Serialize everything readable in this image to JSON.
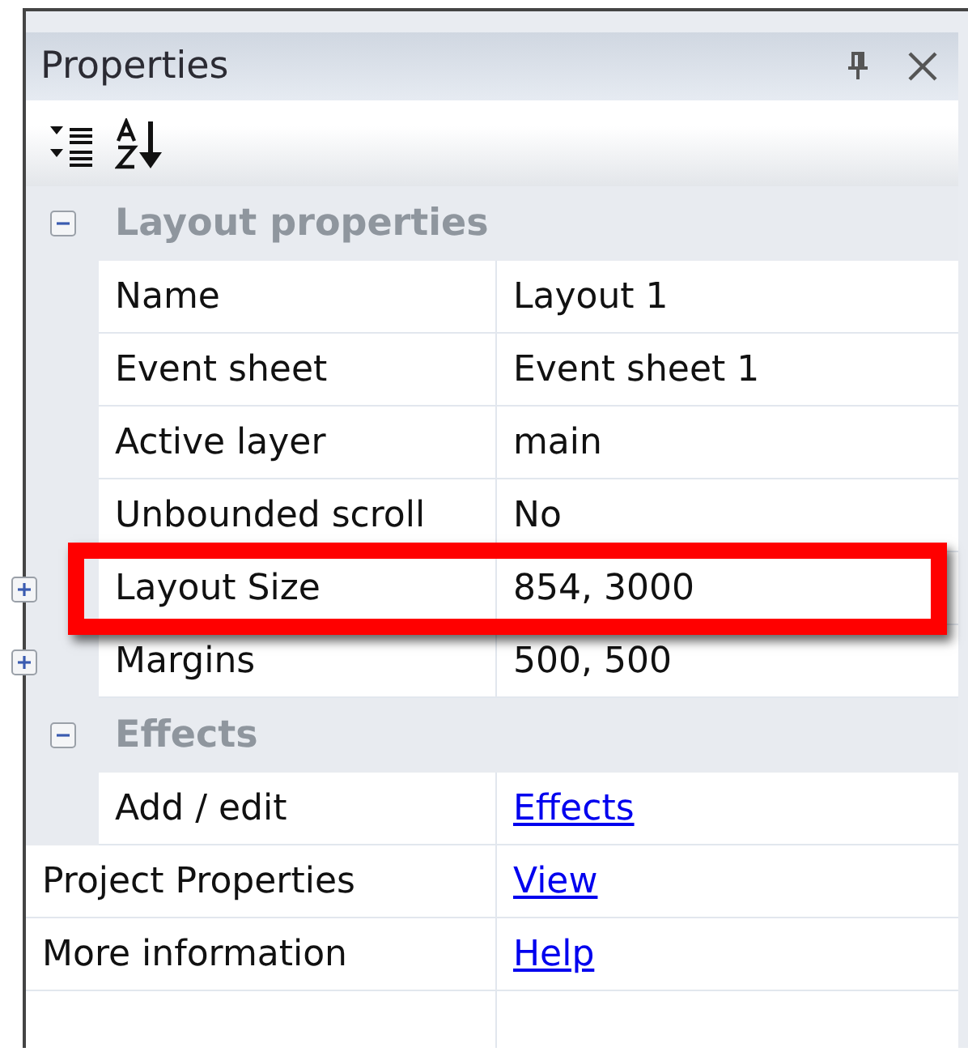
{
  "panel": {
    "title": "Properties"
  },
  "groups": [
    {
      "title": "Layout properties",
      "expanded": true,
      "properties": [
        {
          "name": "Name",
          "value": "Layout 1",
          "kind": "text",
          "highlighted": false
        },
        {
          "name": "Event sheet",
          "value": "Event sheet 1",
          "kind": "text",
          "highlighted": false
        },
        {
          "name": "Active layer",
          "value": "main",
          "kind": "text",
          "highlighted": false
        },
        {
          "name": "Unbounded scroll",
          "value": "No",
          "kind": "text",
          "highlighted": false
        },
        {
          "name": "Layout Size",
          "value": "854, 3000",
          "kind": "expandable",
          "expanded": false,
          "highlighted": true
        },
        {
          "name": "Margins",
          "value": "500, 500",
          "kind": "expandable",
          "expanded": false,
          "highlighted": false
        }
      ]
    },
    {
      "title": "Effects",
      "expanded": true,
      "properties": [
        {
          "name": "Add / edit",
          "value": "Effects",
          "kind": "link",
          "highlighted": false
        }
      ]
    }
  ],
  "footer_rows": [
    {
      "name": "Project Properties",
      "value": "View",
      "kind": "link"
    },
    {
      "name": "More information",
      "value": "Help",
      "kind": "link"
    }
  ]
}
